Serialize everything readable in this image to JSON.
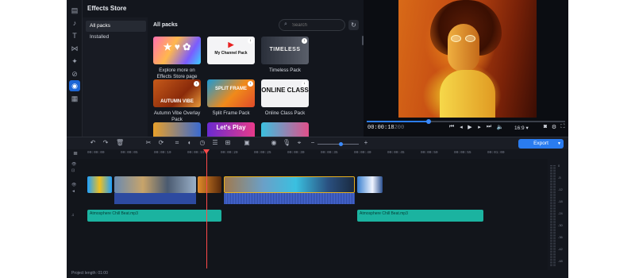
{
  "store": {
    "title": "Effects Store",
    "nav": [
      "All packs",
      "Installed"
    ],
    "packs_title": "All packs",
    "search_placeholder": "Search"
  },
  "packs": [
    {
      "label": "Explore more on Effects Store page",
      "thumb_text": ""
    },
    {
      "label": "",
      "thumb_text": "My Channel Pack"
    },
    {
      "label": "Timeless Pack",
      "thumb_text": "TIMELESS"
    },
    {
      "label": "Autumn Vibe Overlay Pack",
      "thumb_text": "AUTUMN VIBE"
    },
    {
      "label": "Split Frame Pack",
      "thumb_text": "SPLIT FRAME"
    },
    {
      "label": "Online Class Pack",
      "thumb_text": "ONLINE CLASS"
    },
    {
      "label": "",
      "thumb_text": ""
    },
    {
      "label": "",
      "thumb_text": "Let's Play"
    },
    {
      "label": "",
      "thumb_text": ""
    }
  ],
  "player": {
    "time_current": "00:00:18",
    "time_frames": "200",
    "progress": 0.31,
    "aspect_ratio": "16:9"
  },
  "toolbar": {
    "export_label": "Export",
    "zoom": 0.55
  },
  "ruler": [
    "00:00:00",
    "00:00:05",
    "00:00:10",
    "00:00:15",
    "00:00:20",
    "00:00:25",
    "00:00:30",
    "00:00:35",
    "00:00:40",
    "00:00:45",
    "00:00:50",
    "00:00:55",
    "00:01:00"
  ],
  "audio_clips": [
    {
      "label": "Atmosphere Chill Beat.mp3"
    },
    {
      "label": "Atmosphere Chill Beat.mp3"
    }
  ],
  "vu_labels": [
    "0",
    "-5",
    "-12",
    "-18",
    "-24",
    "-30",
    "-36",
    "-42",
    "-48"
  ],
  "footer": {
    "project_length": "Project length: 01:00"
  }
}
